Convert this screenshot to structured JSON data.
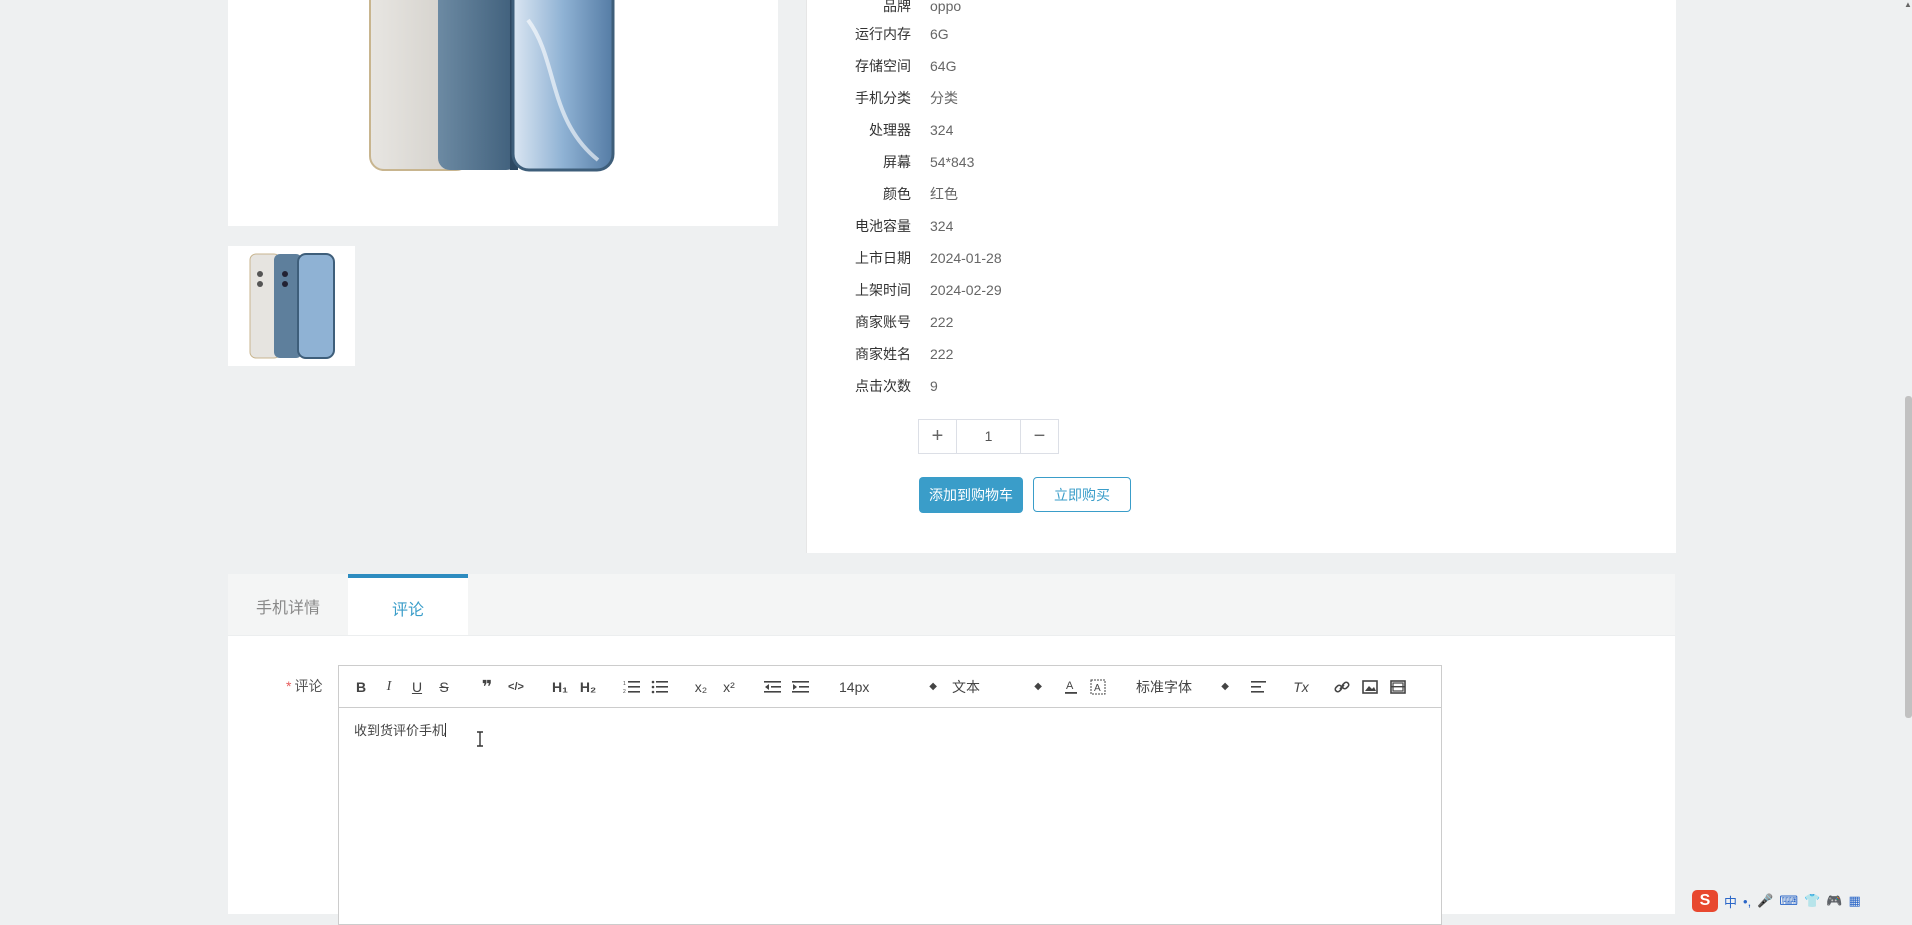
{
  "specs": [
    {
      "label": "品牌",
      "value": "oppo"
    },
    {
      "label": "运行内存",
      "value": "6G"
    },
    {
      "label": "存储空间",
      "value": "64G"
    },
    {
      "label": "手机分类",
      "value": "分类"
    },
    {
      "label": "处理器",
      "value": "324"
    },
    {
      "label": "屏幕",
      "value": "54*843"
    },
    {
      "label": "颜色",
      "value": "红色"
    },
    {
      "label": "电池容量",
      "value": "324"
    },
    {
      "label": "上市日期",
      "value": "2024-01-28"
    },
    {
      "label": "上架时间",
      "value": "2024-02-29"
    },
    {
      "label": "商家账号",
      "value": "222"
    },
    {
      "label": "商家姓名",
      "value": "222"
    },
    {
      "label": "点击次数",
      "value": "9"
    }
  ],
  "quantity": {
    "plus_icon": "+",
    "value": "1",
    "minus_icon": "−"
  },
  "buttons": {
    "add_to_cart": "添加到购物车",
    "buy_now": "立即购买"
  },
  "tabs": [
    {
      "label": "手机详情",
      "active": false
    },
    {
      "label": "评论",
      "active": true
    }
  ],
  "form": {
    "required_mark": "*",
    "comment_label": "评论"
  },
  "toolbar": {
    "bold": "B",
    "italic": "I",
    "underline": "U",
    "strike": "S",
    "blockquote": "❞",
    "code": "</>",
    "h1": "H₁",
    "h2": "H₂",
    "ordered_list": "ol",
    "bullet_list": "ul",
    "subscript": "x₂",
    "superscript": "x²",
    "size_select": "14px",
    "header_select": "文本",
    "font_select": "标准字体",
    "clean": "Tx"
  },
  "editor": {
    "content": "收到货评价手机"
  },
  "colors": {
    "accent": "#3a9dc9",
    "tab_active_border": "#2d8cc0",
    "required": "#e65a5a",
    "ime_logo": "#e8482f"
  },
  "tray": {
    "logo": "S",
    "ime_mode": "中"
  }
}
